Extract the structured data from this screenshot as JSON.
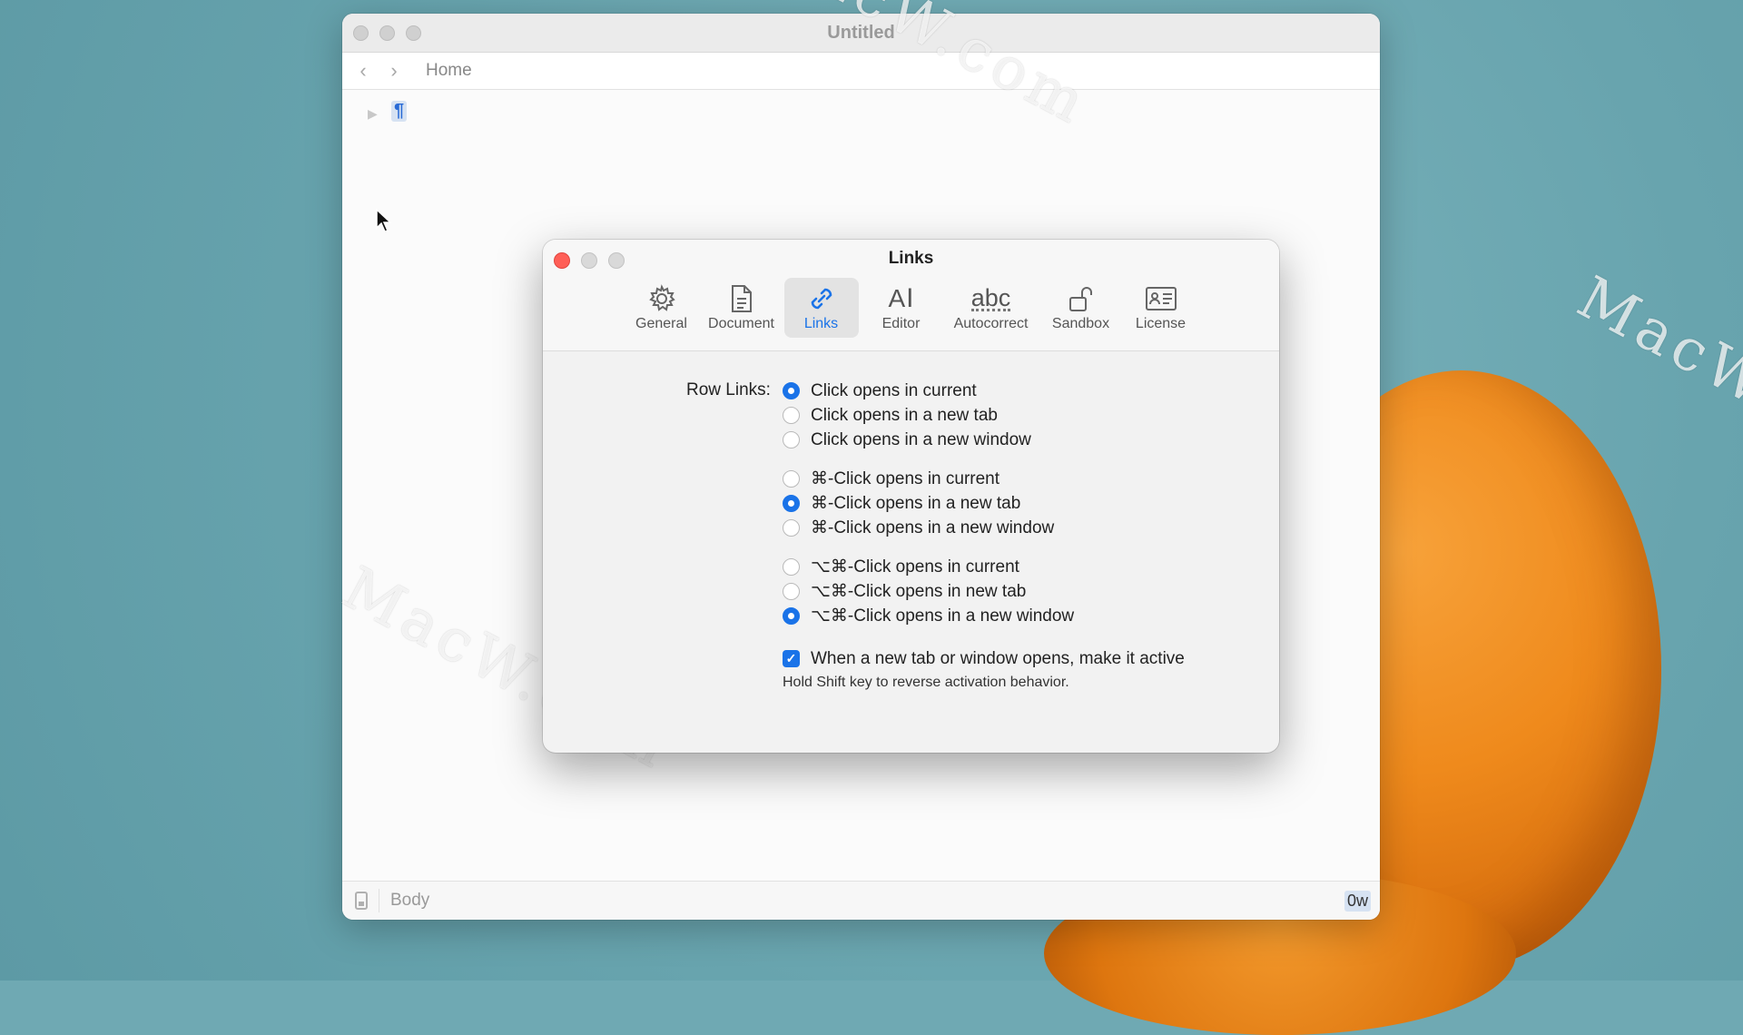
{
  "main_window": {
    "title": "Untitled",
    "breadcrumb": "Home",
    "pilcrow": "¶",
    "status_style": "Body",
    "status_count": "0w"
  },
  "watermark": "MacW.com",
  "prefs": {
    "title": "Links",
    "tabs": [
      {
        "label": "General",
        "icon": "gear-icon"
      },
      {
        "label": "Document",
        "icon": "document-icon"
      },
      {
        "label": "Links",
        "icon": "link-icon",
        "active": true
      },
      {
        "label": "Editor",
        "icon": "text-cursor-icon"
      },
      {
        "label": "Autocorrect",
        "icon": "abc-icon"
      },
      {
        "label": "Sandbox",
        "icon": "unlock-icon"
      },
      {
        "label": "License",
        "icon": "id-card-icon"
      }
    ],
    "autocorrect_glyph": "abc",
    "editor_glyph": "A",
    "row_links_label": "Row Links:",
    "options": [
      {
        "label": "Click opens in current",
        "selected": true
      },
      {
        "label": "Click opens in a new tab",
        "selected": false
      },
      {
        "label": "Click opens in a new window",
        "selected": false
      },
      {
        "label": "⌘-Click opens in current",
        "selected": false
      },
      {
        "label": "⌘-Click opens in a new tab",
        "selected": true
      },
      {
        "label": "⌘-Click opens in a new window",
        "selected": false
      },
      {
        "label": "⌥⌘-Click opens in current",
        "selected": false
      },
      {
        "label": "⌥⌘-Click opens in new tab",
        "selected": false
      },
      {
        "label": "⌥⌘-Click opens in a new window",
        "selected": true
      }
    ],
    "activate_checkbox": {
      "label": "When a new tab or window opens, make it active",
      "checked": true
    },
    "hint": "Hold Shift key to reverse activation behavior."
  },
  "colors": {
    "accent": "#1a73e8",
    "close": "#ff5f57",
    "desktop": "#6fa9b3"
  }
}
